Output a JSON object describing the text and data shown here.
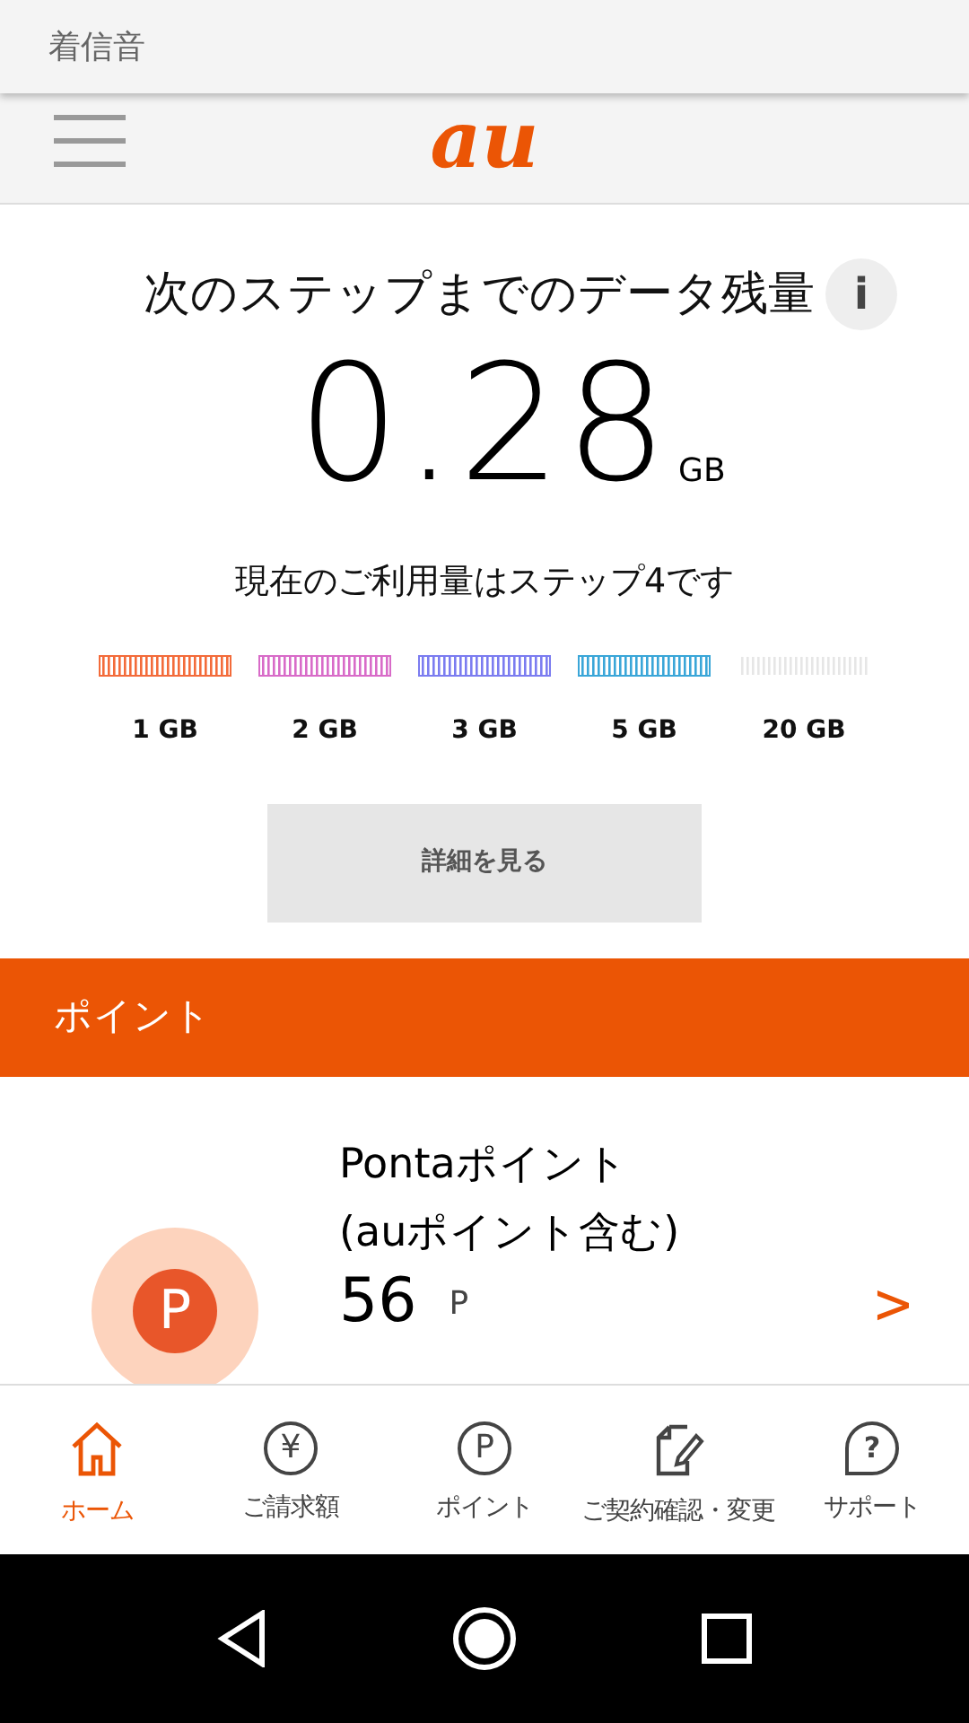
{
  "notification": {
    "title": "着信音"
  },
  "header": {
    "logo": "au"
  },
  "data_remaining": {
    "title": "次のステップまでのデータ残量",
    "info": "i",
    "amount": "0.28",
    "unit": "GB",
    "step_text": "現在のご利用量はステップ4です",
    "steps": [
      {
        "label": "1 GB",
        "reached": true,
        "color": "#f36b3a"
      },
      {
        "label": "2 GB",
        "reached": true,
        "color": "#d86bc8"
      },
      {
        "label": "3 GB",
        "reached": true,
        "color": "#7b7cf0"
      },
      {
        "label": "5 GB",
        "reached": true,
        "color": "#3aa6d8"
      },
      {
        "label": "20 GB",
        "reached": false
      }
    ],
    "details_button": "詳細を見る"
  },
  "points_section": {
    "title": "ポイント",
    "coin": "P",
    "name": "Pontaポイント",
    "name_note": "(auポイント含む)",
    "value": "56",
    "unit": "P",
    "chevron": ">"
  },
  "bottom_nav": [
    {
      "label": "ホーム",
      "kind": "home",
      "selected": true
    },
    {
      "label": "ご請求額",
      "kind": "glyph",
      "glyph": "¥",
      "selected": false
    },
    {
      "label": "ポイント",
      "kind": "glyph",
      "glyph": "P",
      "selected": false
    },
    {
      "label": "ご契約確認・変更",
      "kind": "doc",
      "selected": false
    },
    {
      "label": "サポート",
      "kind": "bubble",
      "glyph": "?",
      "selected": false
    }
  ]
}
